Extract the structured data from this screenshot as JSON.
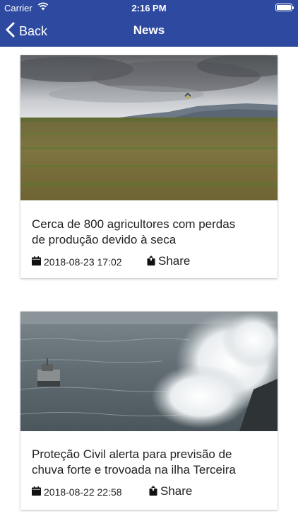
{
  "status_bar": {
    "carrier": "Carrier",
    "time": "2:16 PM"
  },
  "nav": {
    "back_label": "Back",
    "title": "News"
  },
  "articles": [
    {
      "headline_line1": "Cerca de 800 agricultores com perdas",
      "headline_line2": "de produção devido à seca",
      "date": "2018-08-23 17:02",
      "share_label": "Share"
    },
    {
      "headline_line1": "Proteção Civil alerta para previsão de",
      "headline_line2": "chuva forte e trovoada na ilha Terceira",
      "date": "2018-08-22 22:58",
      "share_label": "Share"
    }
  ],
  "colors": {
    "header_bg": "#2e4aa0",
    "header_text": "#ffffff"
  },
  "icons": {
    "back": "chevron-left-icon",
    "date": "calendar-icon",
    "share": "share-icon",
    "wifi": "wifi-icon",
    "battery": "battery-icon"
  }
}
